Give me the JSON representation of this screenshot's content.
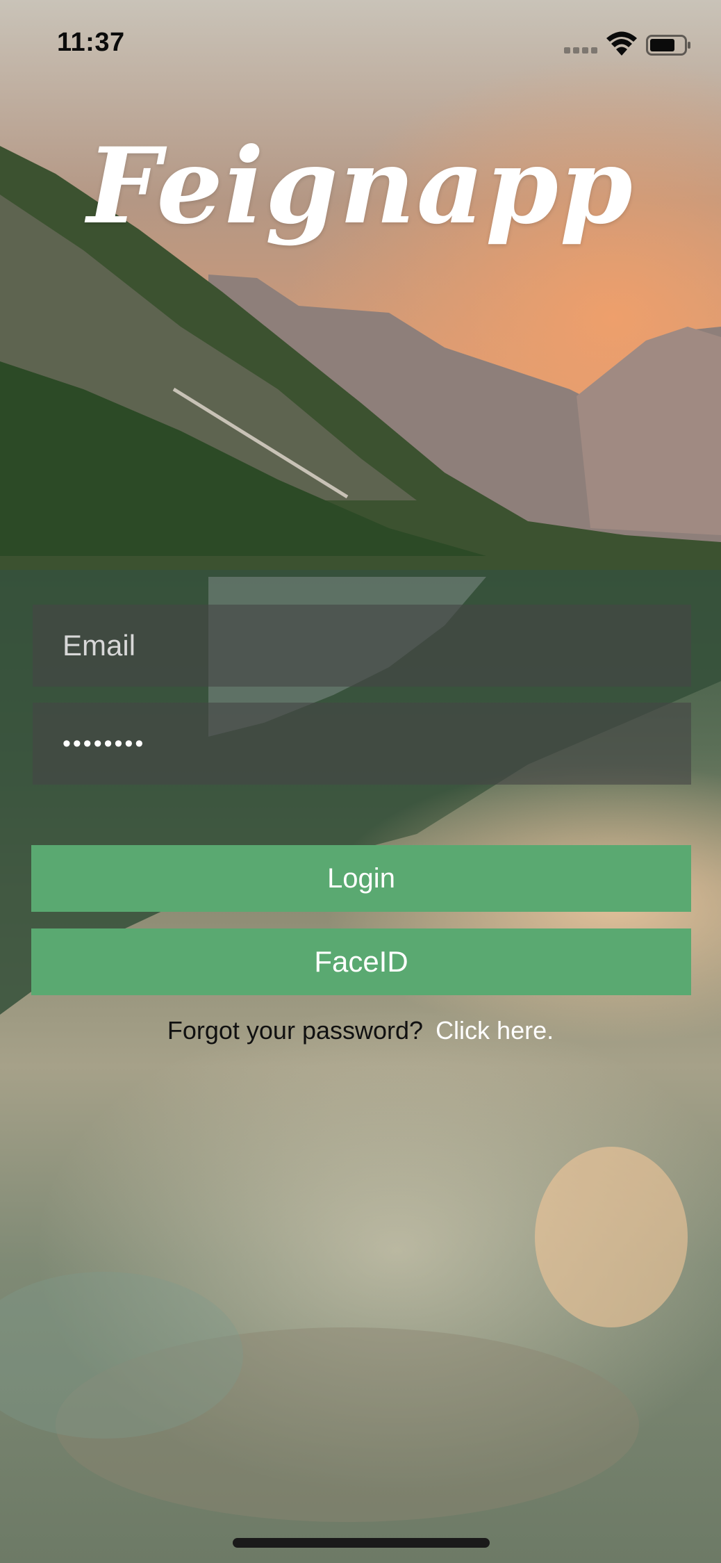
{
  "status_bar": {
    "time": "11:37",
    "signal_icon": "cellular-signal-icon",
    "wifi_icon": "wifi-icon",
    "battery_icon": "battery-icon"
  },
  "app": {
    "logo_text": "Feignapp",
    "background": "mountain-lake-landscape"
  },
  "login_form": {
    "email_placeholder": "Email",
    "password_value": "••••••••",
    "login_label": "Login",
    "faceid_label": "FaceID",
    "forgot_text": "Forgot your password?",
    "forgot_link": "Click here."
  },
  "colors": {
    "button_green": "#5aa971",
    "field_overlay": "#464646"
  }
}
